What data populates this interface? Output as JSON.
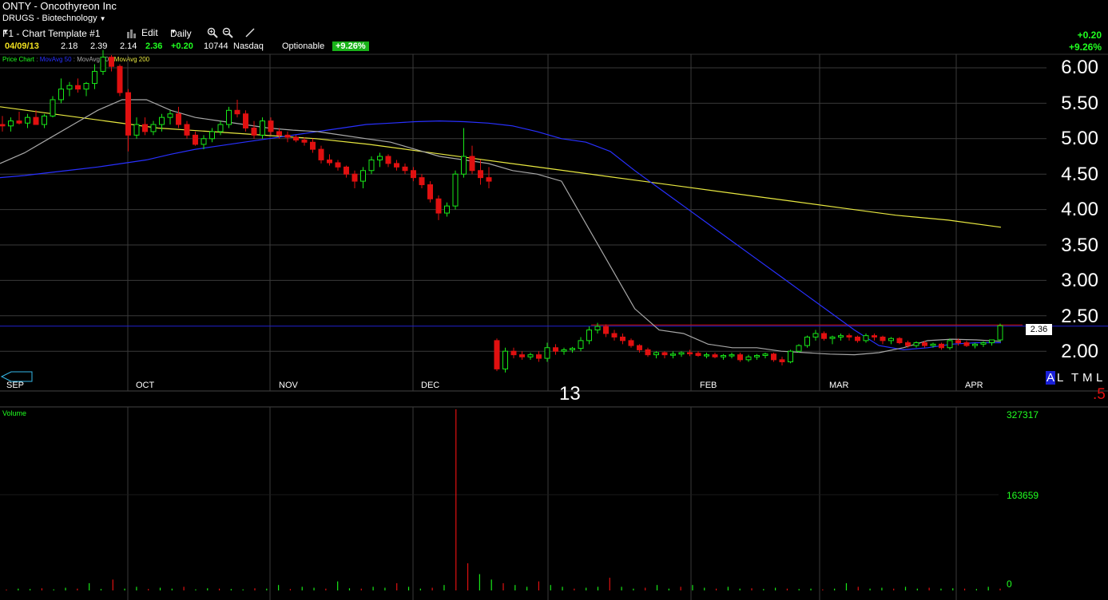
{
  "header": {
    "title": "ONTY - Oncothyreon Inc",
    "sector": "DRUGS - Biotechnology",
    "template": "F1 - Chart Template #1",
    "edit_label": "Edit",
    "period_label": "Daily",
    "change_abs": "+0.20",
    "change_pct": "+9.26%"
  },
  "quote": {
    "date": "04/09/13",
    "open": "2.18",
    "high": "2.39",
    "low": "2.14",
    "close": "2.36",
    "change": "+0.20",
    "volume": "10744",
    "exchange": "Nasdaq",
    "optionable": "Optionable",
    "pct_badge": "+9.26%"
  },
  "indicators": {
    "price_chart": "Price Chart",
    "ma50": "MovAvg 50",
    "ma20": "MovAvg 20",
    "ma200": "MovAvg 200"
  },
  "colors": {
    "up": "#18e818",
    "down": "#e01010",
    "ma50": "#2830ff",
    "ma20": "#a8a8a8",
    "ma200": "#e8e840",
    "grid": "#3a3a3a",
    "last_line": "#d01010"
  },
  "timeframes": {
    "a": "A",
    "l": "L",
    "t": "T",
    "m": "M",
    "l2": "L",
    "half": ".5"
  },
  "year_label": "13",
  "current_price_tag": "2.36",
  "volume": {
    "label": "Volume",
    "max": "327317",
    "mid": "163659",
    "zero": "0"
  },
  "chart_data": {
    "type": "candlestick",
    "title": "ONTY - Oncothyreon Inc",
    "price_axis": {
      "ticks": [
        "6.00",
        "5.50",
        "5.00",
        "4.50",
        "4.00",
        "3.50",
        "3.00",
        "2.50",
        "2.00"
      ],
      "ylim": [
        1.6,
        6.25
      ]
    },
    "months": [
      "SEP",
      "OCT",
      "NOV",
      "DEC",
      "FEB",
      "MAR",
      "APR"
    ],
    "candles": [
      [
        5.2,
        5.32,
        5.1,
        5.18
      ],
      [
        5.18,
        5.3,
        5.1,
        5.25
      ],
      [
        5.25,
        5.38,
        5.2,
        5.22
      ],
      [
        5.22,
        5.35,
        5.15,
        5.3
      ],
      [
        5.3,
        5.4,
        5.2,
        5.2
      ],
      [
        5.2,
        5.35,
        5.15,
        5.32
      ],
      [
        5.32,
        5.6,
        5.3,
        5.55
      ],
      [
        5.55,
        5.85,
        5.5,
        5.7
      ],
      [
        5.7,
        5.8,
        5.6,
        5.75
      ],
      [
        5.75,
        5.85,
        5.65,
        5.7
      ],
      [
        5.7,
        5.8,
        5.6,
        5.78
      ],
      [
        5.78,
        6.05,
        5.7,
        5.95
      ],
      [
        5.95,
        6.25,
        5.9,
        6.15
      ],
      [
        6.15,
        6.18,
        5.95,
        6.02
      ],
      [
        6.02,
        6.05,
        5.6,
        5.65
      ],
      [
        5.65,
        5.7,
        4.82,
        5.05
      ],
      [
        5.05,
        5.3,
        5.0,
        5.2
      ],
      [
        5.2,
        5.3,
        5.05,
        5.1
      ],
      [
        5.1,
        5.25,
        5.05,
        5.2
      ],
      [
        5.2,
        5.35,
        5.1,
        5.3
      ],
      [
        5.3,
        5.4,
        5.2,
        5.35
      ],
      [
        5.35,
        5.45,
        5.15,
        5.2
      ],
      [
        5.2,
        5.25,
        5.0,
        5.05
      ],
      [
        5.05,
        5.1,
        4.9,
        4.92
      ],
      [
        4.92,
        5.05,
        4.85,
        5.0
      ],
      [
        5.0,
        5.15,
        4.95,
        5.1
      ],
      [
        5.1,
        5.25,
        5.05,
        5.2
      ],
      [
        5.2,
        5.45,
        5.15,
        5.4
      ],
      [
        5.4,
        5.55,
        5.3,
        5.35
      ],
      [
        5.35,
        5.4,
        5.1,
        5.15
      ],
      [
        5.15,
        5.25,
        5.0,
        5.05
      ],
      [
        5.05,
        5.3,
        5.0,
        5.25
      ],
      [
        5.25,
        5.3,
        5.05,
        5.1
      ],
      [
        5.1,
        5.15,
        5.0,
        5.05
      ],
      [
        5.05,
        5.1,
        4.95,
        5.02
      ],
      [
        5.02,
        5.05,
        4.95,
        4.98
      ],
      [
        4.98,
        5.02,
        4.9,
        4.95
      ],
      [
        4.95,
        5.0,
        4.8,
        4.85
      ],
      [
        4.85,
        4.9,
        4.65,
        4.7
      ],
      [
        4.7,
        4.78,
        4.62,
        4.66
      ],
      [
        4.66,
        4.7,
        4.55,
        4.6
      ],
      [
        4.6,
        4.62,
        4.45,
        4.5
      ],
      [
        4.5,
        4.55,
        4.3,
        4.4
      ],
      [
        4.4,
        4.6,
        4.3,
        4.55
      ],
      [
        4.55,
        4.75,
        4.5,
        4.7
      ],
      [
        4.7,
        4.8,
        4.6,
        4.75
      ],
      [
        4.75,
        4.78,
        4.6,
        4.65
      ],
      [
        4.65,
        4.7,
        4.55,
        4.6
      ],
      [
        4.6,
        4.65,
        4.5,
        4.55
      ],
      [
        4.55,
        4.6,
        4.4,
        4.45
      ],
      [
        4.45,
        4.5,
        4.3,
        4.35
      ],
      [
        4.35,
        4.4,
        4.1,
        4.15
      ],
      [
        4.15,
        4.2,
        3.85,
        3.95
      ],
      [
        3.95,
        4.1,
        3.9,
        4.05
      ],
      [
        4.05,
        4.55,
        4.0,
        4.5
      ],
      [
        4.5,
        5.15,
        4.45,
        4.75
      ],
      [
        4.75,
        4.9,
        4.5,
        4.55
      ],
      [
        4.55,
        4.7,
        4.35,
        4.45
      ],
      [
        4.45,
        4.6,
        4.3,
        4.4
      ],
      [
        2.15,
        2.18,
        1.72,
        1.75
      ],
      [
        1.75,
        2.05,
        1.7,
        2.0
      ],
      [
        2.0,
        2.05,
        1.9,
        1.95
      ],
      [
        1.95,
        2.0,
        1.88,
        1.92
      ],
      [
        1.92,
        1.98,
        1.88,
        1.95
      ],
      [
        1.95,
        2.0,
        1.85,
        1.9
      ],
      [
        1.9,
        2.12,
        1.85,
        2.05
      ],
      [
        2.05,
        2.1,
        1.95,
        2.0
      ],
      [
        2.0,
        2.05,
        1.95,
        2.02
      ],
      [
        2.02,
        2.06,
        1.98,
        2.04
      ],
      [
        2.04,
        2.2,
        2.0,
        2.15
      ],
      [
        2.15,
        2.35,
        2.1,
        2.3
      ],
      [
        2.3,
        2.4,
        2.25,
        2.35
      ],
      [
        2.35,
        2.38,
        2.2,
        2.25
      ],
      [
        2.25,
        2.3,
        2.15,
        2.2
      ],
      [
        2.2,
        2.25,
        2.1,
        2.15
      ],
      [
        2.15,
        2.18,
        2.05,
        2.08
      ],
      [
        2.08,
        2.1,
        1.98,
        2.02
      ],
      [
        2.02,
        2.05,
        1.92,
        1.95
      ],
      [
        1.95,
        2.0,
        1.9,
        1.98
      ],
      [
        1.98,
        2.0,
        1.9,
        1.95
      ],
      [
        1.95,
        2.0,
        1.9,
        1.96
      ],
      [
        1.96,
        2.0,
        1.92,
        1.98
      ],
      [
        1.98,
        2.02,
        1.93,
        1.97
      ],
      [
        1.97,
        2.0,
        1.92,
        1.94
      ],
      [
        1.94,
        1.98,
        1.9,
        1.95
      ],
      [
        1.95,
        1.98,
        1.9,
        1.92
      ],
      [
        1.92,
        1.96,
        1.88,
        1.94
      ],
      [
        1.94,
        1.98,
        1.9,
        1.95
      ],
      [
        1.95,
        1.98,
        1.85,
        1.88
      ],
      [
        1.88,
        1.95,
        1.85,
        1.92
      ],
      [
        1.92,
        1.96,
        1.88,
        1.94
      ],
      [
        1.94,
        1.98,
        1.9,
        1.96
      ],
      [
        1.96,
        1.98,
        1.85,
        1.88
      ],
      [
        1.88,
        1.92,
        1.8,
        1.85
      ],
      [
        1.85,
        2.02,
        1.83,
        2.0
      ],
      [
        2.0,
        2.1,
        1.98,
        2.08
      ],
      [
        2.08,
        2.22,
        2.05,
        2.2
      ],
      [
        2.2,
        2.3,
        2.15,
        2.25
      ],
      [
        2.25,
        2.28,
        2.15,
        2.18
      ],
      [
        2.18,
        2.22,
        2.1,
        2.2
      ],
      [
        2.2,
        2.25,
        2.15,
        2.22
      ],
      [
        2.22,
        2.25,
        2.15,
        2.2
      ],
      [
        2.2,
        2.22,
        2.12,
        2.15
      ],
      [
        2.15,
        2.25,
        2.12,
        2.22
      ],
      [
        2.22,
        2.25,
        2.15,
        2.2
      ],
      [
        2.2,
        2.22,
        2.1,
        2.15
      ],
      [
        2.15,
        2.2,
        2.1,
        2.18
      ],
      [
        2.18,
        2.2,
        2.1,
        2.12
      ],
      [
        2.12,
        2.15,
        2.05,
        2.08
      ],
      [
        2.08,
        2.14,
        2.05,
        2.12
      ],
      [
        2.12,
        2.15,
        2.05,
        2.08
      ],
      [
        2.08,
        2.12,
        2.05,
        2.1
      ],
      [
        2.1,
        2.12,
        2.02,
        2.05
      ],
      [
        2.05,
        2.18,
        2.02,
        2.15
      ],
      [
        2.15,
        2.18,
        2.08,
        2.12
      ],
      [
        2.12,
        2.15,
        2.06,
        2.08
      ],
      [
        2.08,
        2.12,
        2.04,
        2.1
      ],
      [
        2.1,
        2.14,
        2.06,
        2.12
      ],
      [
        2.12,
        2.16,
        2.08,
        2.16
      ],
      [
        2.16,
        2.39,
        2.14,
        2.36
      ]
    ],
    "ma50": [
      4.45,
      4.48,
      4.52,
      4.56,
      4.6,
      4.65,
      4.7,
      4.78,
      4.85,
      4.9,
      4.95,
      5.0,
      5.05,
      5.1,
      5.15,
      5.2,
      5.22,
      5.24,
      5.25,
      5.24,
      5.22,
      5.18,
      5.1,
      5.0,
      4.95,
      4.82,
      4.55,
      4.3,
      4.05,
      3.8,
      3.55,
      3.3,
      3.05,
      2.8,
      2.55,
      2.3,
      2.08,
      2.02,
      2.05,
      2.1,
      2.12,
      2.12
    ],
    "ma20": [
      4.65,
      4.8,
      5.0,
      5.2,
      5.4,
      5.55,
      5.55,
      5.4,
      5.3,
      5.25,
      5.2,
      5.15,
      5.12,
      5.1,
      5.05,
      5.0,
      4.95,
      4.85,
      4.75,
      4.7,
      4.65,
      4.55,
      4.5,
      4.4,
      3.8,
      3.2,
      2.6,
      2.3,
      2.25,
      2.1,
      2.05,
      2.05,
      2.0,
      1.98,
      1.96,
      1.95,
      1.98,
      2.05,
      2.15,
      2.17,
      2.16,
      2.14
    ],
    "ma200_x": [
      0,
      1253
    ],
    "ma200": [
      5.45,
      5.35,
      5.25,
      5.15,
      5.1,
      5.05,
      5.0,
      4.92,
      4.82,
      4.72,
      4.62,
      4.52,
      4.42,
      4.32,
      4.22,
      4.12,
      4.02,
      3.92,
      3.85,
      3.75
    ],
    "volume_values": [
      0.005,
      0.01,
      0.008,
      0.012,
      0.006,
      0.015,
      0.01,
      0.04,
      0.008,
      0.06,
      0.01,
      0.02,
      0.008,
      0.015,
      0.01,
      0.02,
      0.006,
      0.012,
      0.01,
      0.008,
      0.006,
      0.012,
      0.01,
      0.03,
      0.008,
      0.02,
      0.015,
      0.01,
      0.05,
      0.012,
      0.01,
      0.02,
      0.015,
      0.04,
      0.02,
      0.01,
      0.015,
      0.03,
      1.0,
      0.15,
      0.09,
      0.06,
      0.04,
      0.03,
      0.02,
      0.05,
      0.03,
      0.02,
      0.01,
      0.015,
      0.02,
      0.07,
      0.02,
      0.01,
      0.015,
      0.03,
      0.01,
      0.02,
      0.03,
      0.015,
      0.01,
      0.02,
      0.01,
      0.012,
      0.008,
      0.015,
      0.01,
      0.008,
      0.01,
      0.006,
      0.01,
      0.04,
      0.02,
      0.01,
      0.015,
      0.01,
      0.02,
      0.01,
      0.015,
      0.01,
      0.012,
      0.01,
      0.008,
      0.02,
      0.01
    ]
  }
}
